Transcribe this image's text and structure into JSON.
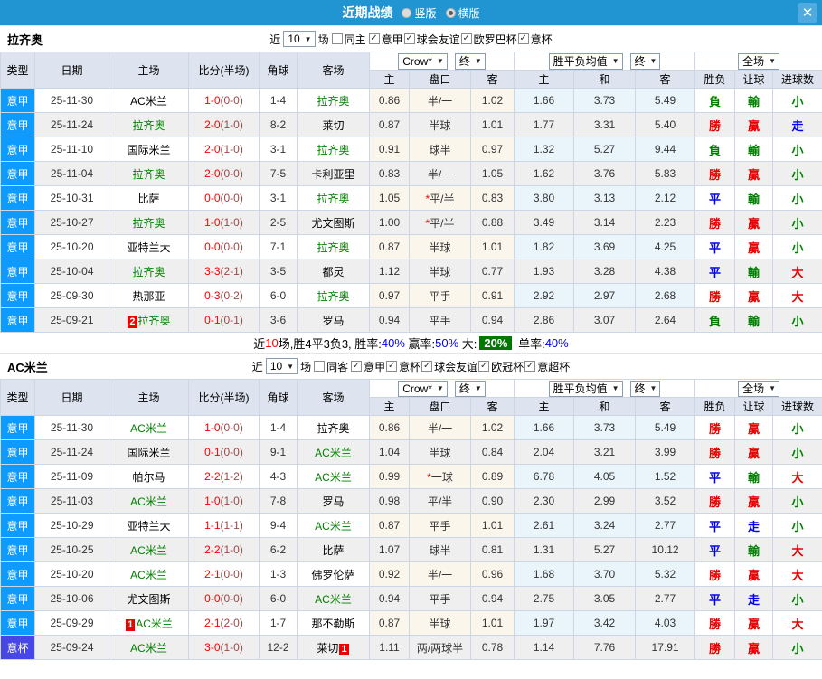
{
  "titlebar": {
    "title": "近期战绩",
    "radio_vertical": "竖版",
    "radio_horizontal": "横版",
    "selected_layout": "横版",
    "close_icon": "✕"
  },
  "common": {
    "near_label": "近",
    "games_label": "场",
    "dropdowns": {
      "company": "Crow*",
      "final": "终",
      "wdl_avg": "胜平负均值",
      "final2": "终",
      "scope": "全场"
    },
    "columns": [
      "类型",
      "日期",
      "主场",
      "比分(半场)",
      "角球",
      "客场",
      "主",
      "盘口",
      "客",
      "主",
      "和",
      "客",
      "胜负",
      "让球",
      "进球数"
    ]
  },
  "league_colors": {
    "意甲": "#0d9bff",
    "意杯": "#4747e8"
  },
  "result_colors": {
    "勝": "#e60000",
    "負": "#008000",
    "平": "#0000ee",
    "贏": "#e60000",
    "輸": "#008000",
    "走": "#0000ee",
    "大": "#e60000",
    "小": "#008000"
  },
  "sections": [
    {
      "team": "拉齐奥",
      "count": "10",
      "same_venue_label": "同主",
      "same_venue_checked": false,
      "filters": [
        "意甲",
        "球会友谊",
        "欧罗巴杯",
        "意杯"
      ],
      "rows": [
        {
          "lg": "意甲",
          "d": "25-11-30",
          "h": "AC米兰",
          "hg": 0,
          "hb": "",
          "s": "1-0",
          "sh": "(0-0)",
          "cn": "1-4",
          "a": "拉齐奥",
          "ag": 1,
          "ab": "",
          "o1": "0.86",
          "st": 0,
          "hc": "半/一",
          "o2": "1.02",
          "e1": "1.66",
          "e2": "3.73",
          "e3": "5.49",
          "r": "負",
          "v": "輸",
          "u": "小"
        },
        {
          "lg": "意甲",
          "d": "25-11-24",
          "h": "拉齐奥",
          "hg": 1,
          "hb": "",
          "s": "2-0",
          "sh": "(1-0)",
          "cn": "8-2",
          "a": "莱切",
          "ag": 0,
          "ab": "",
          "o1": "0.87",
          "st": 0,
          "hc": "半球",
          "o2": "1.01",
          "e1": "1.77",
          "e2": "3.31",
          "e3": "5.40",
          "r": "勝",
          "v": "贏",
          "u": "走"
        },
        {
          "lg": "意甲",
          "d": "25-11-10",
          "h": "国际米兰",
          "hg": 0,
          "hb": "",
          "s": "2-0",
          "sh": "(1-0)",
          "cn": "3-1",
          "a": "拉齐奥",
          "ag": 1,
          "ab": "",
          "o1": "0.91",
          "st": 0,
          "hc": "球半",
          "o2": "0.97",
          "e1": "1.32",
          "e2": "5.27",
          "e3": "9.44",
          "r": "負",
          "v": "輸",
          "u": "小"
        },
        {
          "lg": "意甲",
          "d": "25-11-04",
          "h": "拉齐奥",
          "hg": 1,
          "hb": "",
          "s": "2-0",
          "sh": "(0-0)",
          "cn": "7-5",
          "a": "卡利亚里",
          "ag": 0,
          "ab": "",
          "o1": "0.83",
          "st": 0,
          "hc": "半/一",
          "o2": "1.05",
          "e1": "1.62",
          "e2": "3.76",
          "e3": "5.83",
          "r": "勝",
          "v": "贏",
          "u": "小"
        },
        {
          "lg": "意甲",
          "d": "25-10-31",
          "h": "比萨",
          "hg": 0,
          "hb": "",
          "s": "0-0",
          "sh": "(0-0)",
          "cn": "3-1",
          "a": "拉齐奥",
          "ag": 1,
          "ab": "",
          "o1": "1.05",
          "st": 1,
          "hc": "平/半",
          "o2": "0.83",
          "e1": "3.80",
          "e2": "3.13",
          "e3": "2.12",
          "r": "平",
          "v": "輸",
          "u": "小"
        },
        {
          "lg": "意甲",
          "d": "25-10-27",
          "h": "拉齐奥",
          "hg": 1,
          "hb": "",
          "s": "1-0",
          "sh": "(1-0)",
          "cn": "2-5",
          "a": "尤文图斯",
          "ag": 0,
          "ab": "",
          "o1": "1.00",
          "st": 1,
          "hc": "平/半",
          "o2": "0.88",
          "e1": "3.49",
          "e2": "3.14",
          "e3": "2.23",
          "r": "勝",
          "v": "贏",
          "u": "小"
        },
        {
          "lg": "意甲",
          "d": "25-10-20",
          "h": "亚特兰大",
          "hg": 0,
          "hb": "",
          "s": "0-0",
          "sh": "(0-0)",
          "cn": "7-1",
          "a": "拉齐奥",
          "ag": 1,
          "ab": "",
          "o1": "0.87",
          "st": 0,
          "hc": "半球",
          "o2": "1.01",
          "e1": "1.82",
          "e2": "3.69",
          "e3": "4.25",
          "r": "平",
          "v": "贏",
          "u": "小"
        },
        {
          "lg": "意甲",
          "d": "25-10-04",
          "h": "拉齐奥",
          "hg": 1,
          "hb": "",
          "s": "3-3",
          "sh": "(2-1)",
          "cn": "3-5",
          "a": "都灵",
          "ag": 0,
          "ab": "",
          "o1": "1.12",
          "st": 0,
          "hc": "半球",
          "o2": "0.77",
          "e1": "1.93",
          "e2": "3.28",
          "e3": "4.38",
          "r": "平",
          "v": "輸",
          "u": "大"
        },
        {
          "lg": "意甲",
          "d": "25-09-30",
          "h": "热那亚",
          "hg": 0,
          "hb": "",
          "s": "0-3",
          "sh": "(0-2)",
          "cn": "6-0",
          "a": "拉齐奥",
          "ag": 1,
          "ab": "",
          "o1": "0.97",
          "st": 0,
          "hc": "平手",
          "o2": "0.91",
          "e1": "2.92",
          "e2": "2.97",
          "e3": "2.68",
          "r": "勝",
          "v": "贏",
          "u": "大"
        },
        {
          "lg": "意甲",
          "d": "25-09-21",
          "h": "拉齐奥",
          "hg": 1,
          "hb": "2",
          "s": "0-1",
          "sh": "(0-1)",
          "cn": "3-6",
          "a": "罗马",
          "ag": 0,
          "ab": "",
          "o1": "0.94",
          "st": 0,
          "hc": "平手",
          "o2": "0.94",
          "e1": "2.86",
          "e2": "3.07",
          "e3": "2.64",
          "r": "負",
          "v": "輸",
          "u": "小"
        }
      ],
      "summary": {
        "pre": "近",
        "count": "10",
        "mid": "场,胜4平3负3, 胜率:",
        "win_rate": "40%",
        "label_cover": " 赢率:",
        "cover_rate": "50%",
        "label_big": " 大:",
        "big_rate": "20%",
        "label_single": " 单率:",
        "single_rate": "40%"
      }
    },
    {
      "team": "AC米兰",
      "count": "10",
      "same_venue_label": "同客",
      "same_venue_checked": false,
      "filters": [
        "意甲",
        "意杯",
        "球会友谊",
        "欧冠杯",
        "意超杯"
      ],
      "rows": [
        {
          "lg": "意甲",
          "d": "25-11-30",
          "h": "AC米兰",
          "hg": 1,
          "hb": "",
          "s": "1-0",
          "sh": "(0-0)",
          "cn": "1-4",
          "a": "拉齐奥",
          "ag": 0,
          "ab": "",
          "o1": "0.86",
          "st": 0,
          "hc": "半/一",
          "o2": "1.02",
          "e1": "1.66",
          "e2": "3.73",
          "e3": "5.49",
          "r": "勝",
          "v": "贏",
          "u": "小"
        },
        {
          "lg": "意甲",
          "d": "25-11-24",
          "h": "国际米兰",
          "hg": 0,
          "hb": "",
          "s": "0-1",
          "sh": "(0-0)",
          "cn": "9-1",
          "a": "AC米兰",
          "ag": 1,
          "ab": "",
          "o1": "1.04",
          "st": 0,
          "hc": "半球",
          "o2": "0.84",
          "e1": "2.04",
          "e2": "3.21",
          "e3": "3.99",
          "r": "勝",
          "v": "贏",
          "u": "小"
        },
        {
          "lg": "意甲",
          "d": "25-11-09",
          "h": "帕尔马",
          "hg": 0,
          "hb": "",
          "s": "2-2",
          "sh": "(1-2)",
          "cn": "4-3",
          "a": "AC米兰",
          "ag": 1,
          "ab": "",
          "o1": "0.99",
          "st": 1,
          "hc": "一球",
          "o2": "0.89",
          "e1": "6.78",
          "e2": "4.05",
          "e3": "1.52",
          "r": "平",
          "v": "輸",
          "u": "大"
        },
        {
          "lg": "意甲",
          "d": "25-11-03",
          "h": "AC米兰",
          "hg": 1,
          "hb": "",
          "s": "1-0",
          "sh": "(1-0)",
          "cn": "7-8",
          "a": "罗马",
          "ag": 0,
          "ab": "",
          "o1": "0.98",
          "st": 0,
          "hc": "平/半",
          "o2": "0.90",
          "e1": "2.30",
          "e2": "2.99",
          "e3": "3.52",
          "r": "勝",
          "v": "贏",
          "u": "小"
        },
        {
          "lg": "意甲",
          "d": "25-10-29",
          "h": "亚特兰大",
          "hg": 0,
          "hb": "",
          "s": "1-1",
          "sh": "(1-1)",
          "cn": "9-4",
          "a": "AC米兰",
          "ag": 1,
          "ab": "",
          "o1": "0.87",
          "st": 0,
          "hc": "平手",
          "o2": "1.01",
          "e1": "2.61",
          "e2": "3.24",
          "e3": "2.77",
          "r": "平",
          "v": "走",
          "u": "小"
        },
        {
          "lg": "意甲",
          "d": "25-10-25",
          "h": "AC米兰",
          "hg": 1,
          "hb": "",
          "s": "2-2",
          "sh": "(1-0)",
          "cn": "6-2",
          "a": "比萨",
          "ag": 0,
          "ab": "",
          "o1": "1.07",
          "st": 0,
          "hc": "球半",
          "o2": "0.81",
          "e1": "1.31",
          "e2": "5.27",
          "e3": "10.12",
          "r": "平",
          "v": "輸",
          "u": "大"
        },
        {
          "lg": "意甲",
          "d": "25-10-20",
          "h": "AC米兰",
          "hg": 1,
          "hb": "",
          "s": "2-1",
          "sh": "(0-0)",
          "cn": "1-3",
          "a": "佛罗伦萨",
          "ag": 0,
          "ab": "",
          "o1": "0.92",
          "st": 0,
          "hc": "半/一",
          "o2": "0.96",
          "e1": "1.68",
          "e2": "3.70",
          "e3": "5.32",
          "r": "勝",
          "v": "贏",
          "u": "大"
        },
        {
          "lg": "意甲",
          "d": "25-10-06",
          "h": "尤文图斯",
          "hg": 0,
          "hb": "",
          "s": "0-0",
          "sh": "(0-0)",
          "cn": "6-0",
          "a": "AC米兰",
          "ag": 1,
          "ab": "",
          "o1": "0.94",
          "st": 0,
          "hc": "平手",
          "o2": "0.94",
          "e1": "2.75",
          "e2": "3.05",
          "e3": "2.77",
          "r": "平",
          "v": "走",
          "u": "小"
        },
        {
          "lg": "意甲",
          "d": "25-09-29",
          "h": "AC米兰",
          "hg": 1,
          "hb": "1",
          "s": "2-1",
          "sh": "(2-0)",
          "cn": "1-7",
          "a": "那不勒斯",
          "ag": 0,
          "ab": "",
          "o1": "0.87",
          "st": 0,
          "hc": "半球",
          "o2": "1.01",
          "e1": "1.97",
          "e2": "3.42",
          "e3": "4.03",
          "r": "勝",
          "v": "贏",
          "u": "大"
        },
        {
          "lg": "意杯",
          "d": "25-09-24",
          "h": "AC米兰",
          "hg": 1,
          "hb": "",
          "s": "3-0",
          "sh": "(1-0)",
          "cn": "12-2",
          "a": "莱切",
          "ag": 0,
          "ab": "1",
          "o1": "1.11",
          "st": 0,
          "hc": "两/两球半",
          "o2": "0.78",
          "e1": "1.14",
          "e2": "7.76",
          "e3": "17.91",
          "r": "勝",
          "v": "贏",
          "u": "小"
        }
      ]
    }
  ]
}
